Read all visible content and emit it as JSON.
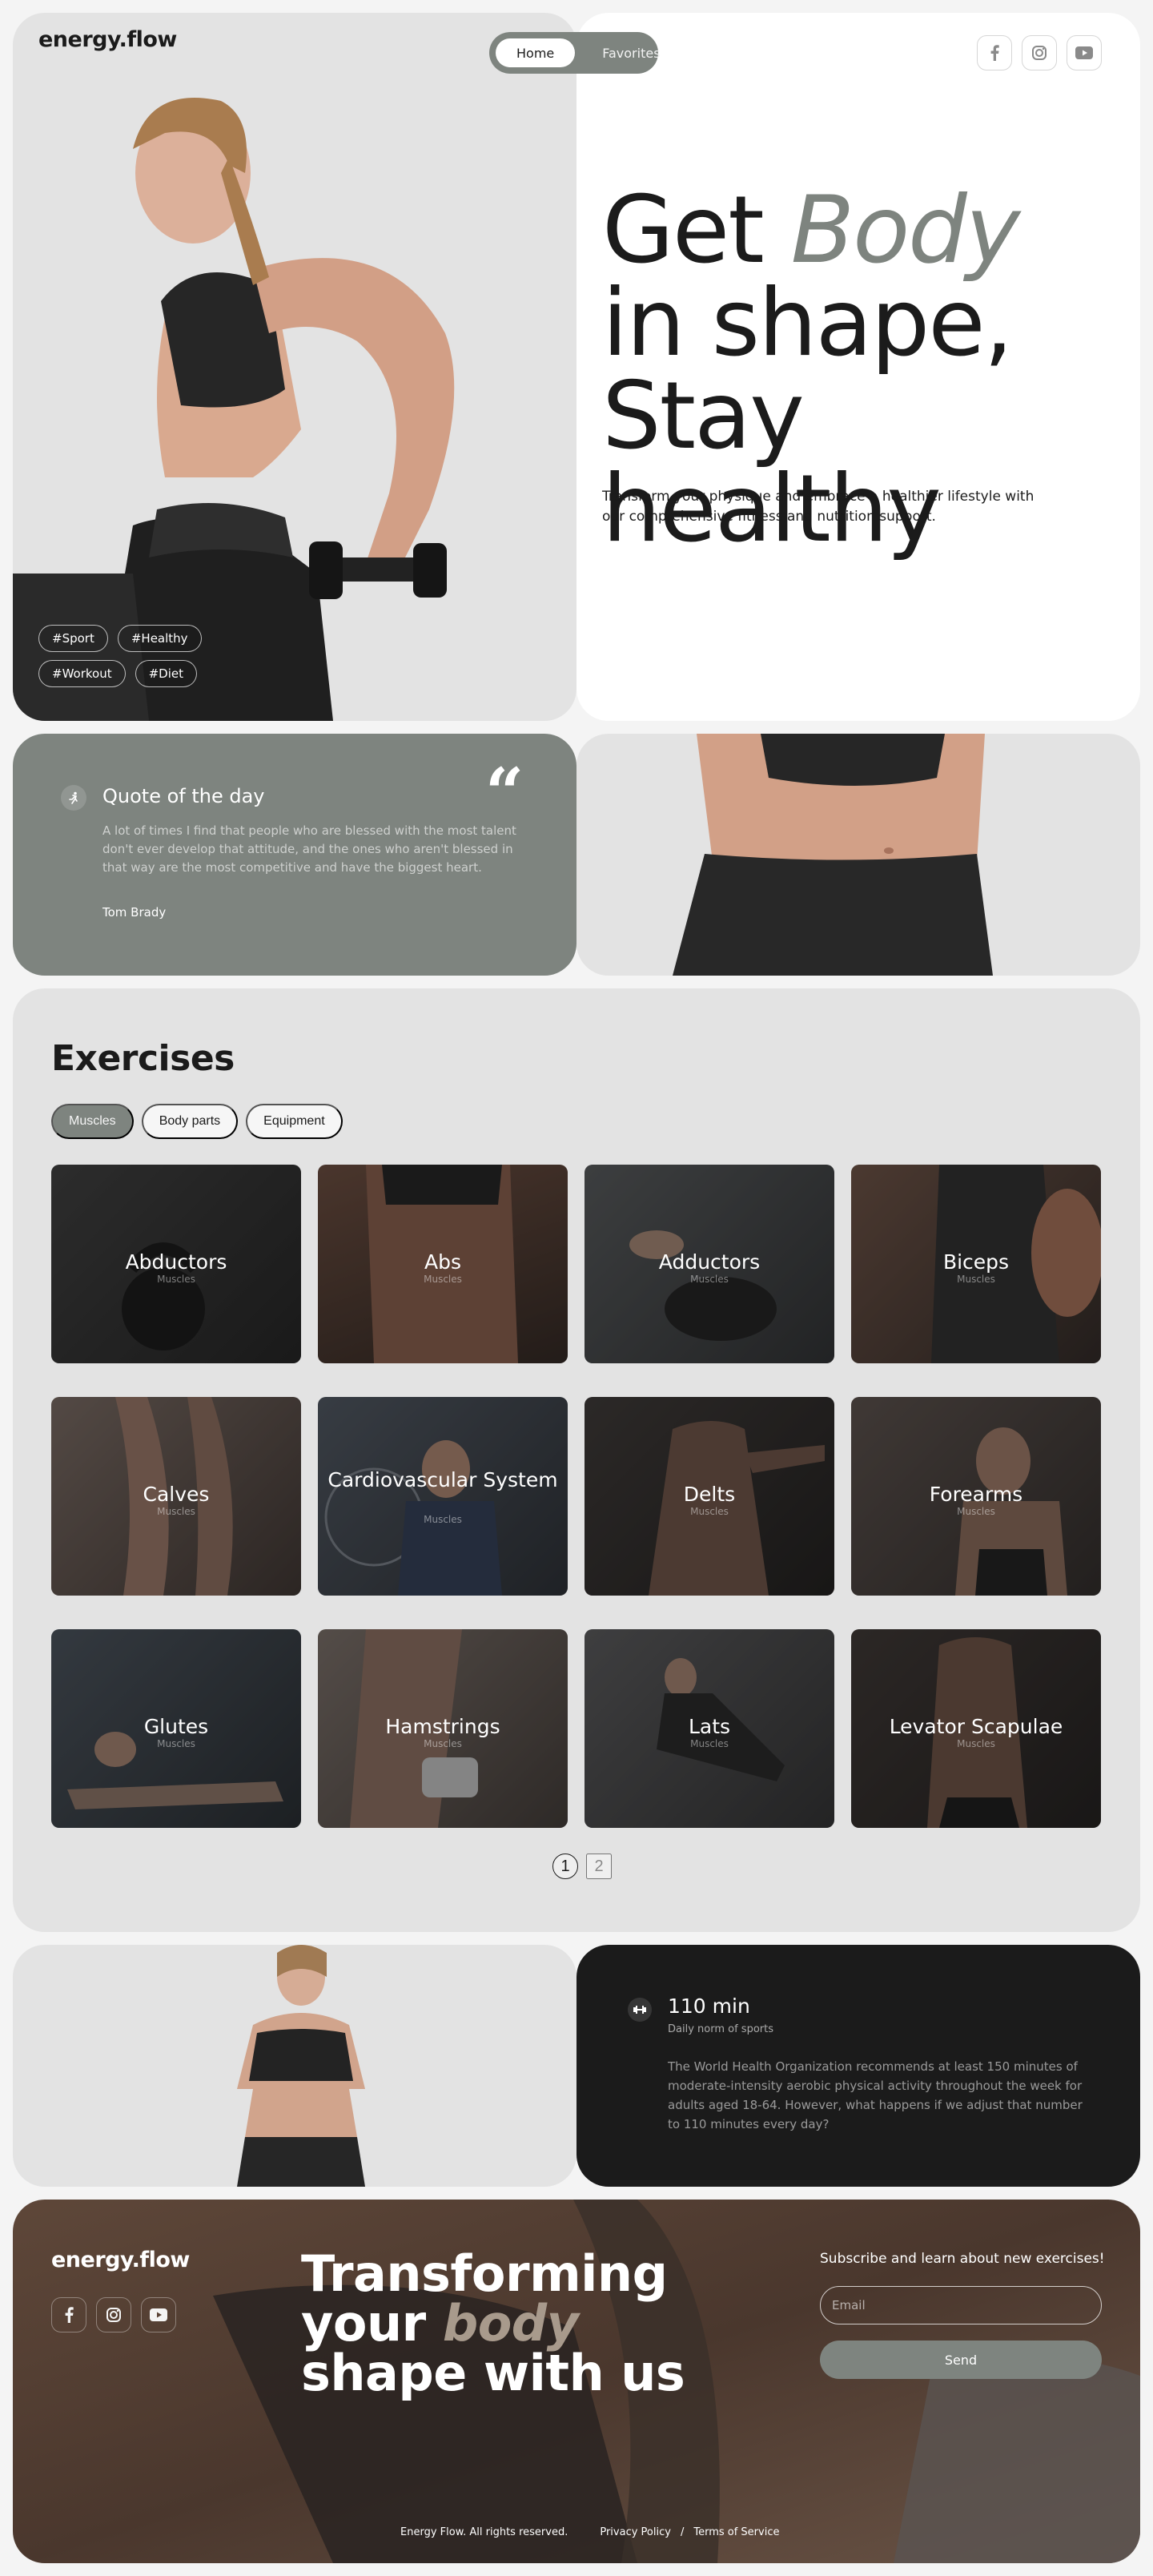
{
  "brand": {
    "logo": "energy.flow"
  },
  "nav": {
    "items": [
      "Home",
      "Favorites"
    ],
    "active": "Home"
  },
  "social_icons": [
    "facebook-icon",
    "instagram-icon",
    "youtube-icon"
  ],
  "hero": {
    "title_1": "Get ",
    "title_italic": "Body",
    "title_2": " in shape, Stay healthy",
    "text": "Transform your physique and embrace a healthier lifestyle with our comprehensive fitness and nutrition support.",
    "tags": [
      "#Sport",
      "#Healthy",
      "#Workout",
      "#Diet"
    ]
  },
  "quote": {
    "title": "Quote of the day",
    "text": "A lot of times I find that people who are blessed with the most talent don't ever develop that attitude, and the ones who aren't blessed in that way are the most competitive and have the biggest heart.",
    "author": "Tom Brady",
    "mark": "“"
  },
  "exercises": {
    "title": "Exercises",
    "filters": [
      "Muscles",
      "Body parts",
      "Equipment"
    ],
    "active_filter": "Muscles",
    "cards": [
      {
        "name": "Abductors",
        "category": "Muscles"
      },
      {
        "name": "Abs",
        "category": "Muscles"
      },
      {
        "name": "Adductors",
        "category": "Muscles"
      },
      {
        "name": "Biceps",
        "category": "Muscles"
      },
      {
        "name": "Calves",
        "category": "Muscles"
      },
      {
        "name": "Cardiovascular System",
        "category": "Muscles"
      },
      {
        "name": "Delts",
        "category": "Muscles"
      },
      {
        "name": "Forearms",
        "category": "Muscles"
      },
      {
        "name": "Glutes",
        "category": "Muscles"
      },
      {
        "name": "Hamstrings",
        "category": "Muscles"
      },
      {
        "name": "Lats",
        "category": "Muscles"
      },
      {
        "name": "Levator Scapulae",
        "category": "Muscles"
      }
    ],
    "pagination": {
      "pages": [
        "1",
        "2"
      ],
      "current": "1"
    }
  },
  "daily": {
    "minutes": "110 min",
    "subtitle": "Daily  norm of sports",
    "text": "The World Health Organization recommends at least 150 minutes of moderate-intensity aerobic physical activity throughout the week for adults aged 18-64. However, what happens if we adjust that number to 110 minutes every day?"
  },
  "footer": {
    "logo": "energy.flow",
    "title_1": "Transforming your ",
    "title_italic": "body",
    "title_2": " shape with us",
    "subscribe_label": "Subscribe and learn about new exercises!",
    "email_placeholder": "Email",
    "send_label": "Send",
    "copyright": "Energy Flow. All rights reserved.",
    "privacy": "Privacy Policy",
    "separator": "/",
    "terms": "Terms of Service"
  },
  "colors": {
    "accent": "#7e847f",
    "dark": "#1b1b1b",
    "panel": "#e3e3e3",
    "background": "#f4f4f4",
    "footer_brown": "#5a4336"
  }
}
